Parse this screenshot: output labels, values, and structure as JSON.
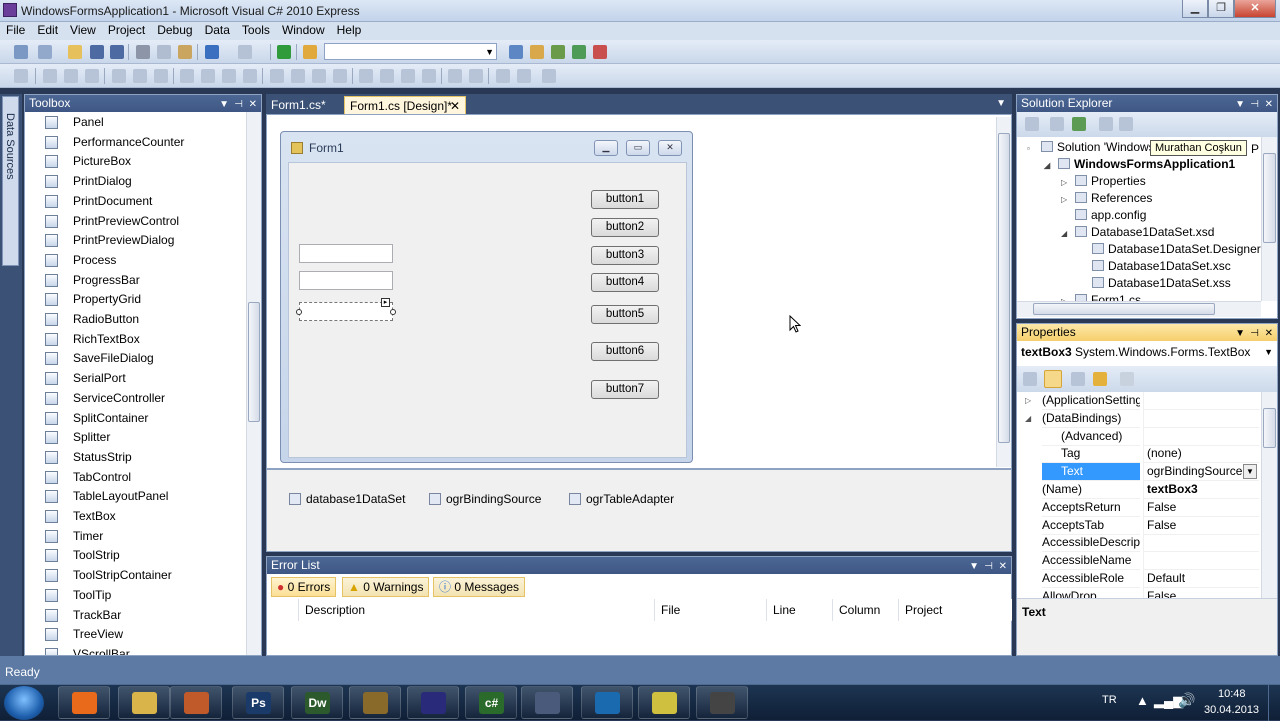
{
  "window": {
    "title": "WindowsFormsApplication1 - Microsoft Visual C# 2010 Express",
    "minimize": "▁",
    "maximize": "❐",
    "close": "✕"
  },
  "menu": [
    "File",
    "Edit",
    "View",
    "Project",
    "Debug",
    "Data",
    "Tools",
    "Window",
    "Help"
  ],
  "data_sources_tab": "Data Sources",
  "toolbox": {
    "title": "Toolbox",
    "items": [
      "Panel",
      "PerformanceCounter",
      "PictureBox",
      "PrintDialog",
      "PrintDocument",
      "PrintPreviewControl",
      "PrintPreviewDialog",
      "Process",
      "ProgressBar",
      "PropertyGrid",
      "RadioButton",
      "RichTextBox",
      "SaveFileDialog",
      "SerialPort",
      "ServiceController",
      "SplitContainer",
      "Splitter",
      "StatusStrip",
      "TabControl",
      "TableLayoutPanel",
      "TextBox",
      "Timer",
      "ToolStrip",
      "ToolStripContainer",
      "ToolTip",
      "TrackBar",
      "TreeView",
      "VScrollBar"
    ]
  },
  "doc_tabs": [
    "Form1.cs*",
    "Form1.cs [Design]*"
  ],
  "form": {
    "title": "Form1",
    "buttons": [
      "button1",
      "button2",
      "button3",
      "button4",
      "button5",
      "button6",
      "button7"
    ]
  },
  "component_tray": [
    "database1DataSet",
    "ogrBindingSource",
    "ogrTableAdapter"
  ],
  "error_list": {
    "title": "Error List",
    "errors": "0 Errors",
    "warnings": "0 Warnings",
    "messages": "0 Messages",
    "columns": [
      "Description",
      "File",
      "Line",
      "Column",
      "Project"
    ]
  },
  "solution_explorer": {
    "title": "Solution Explorer",
    "tooltip": "Murathan Coşkun",
    "items": [
      "Solution 'WindowsFor",
      "WindowsFormsApplication1",
      "Properties",
      "References",
      "app.config",
      "Database1DataSet.xsd",
      "Database1DataSet.Designer.cs",
      "Database1DataSet.xsc",
      "Database1DataSet.xss",
      "Form1.cs"
    ],
    "trail": "P"
  },
  "properties": {
    "title": "Properties",
    "object": "textBox3",
    "type": "System.Windows.Forms.TextBox",
    "rows": [
      {
        "k": "(ApplicationSettings)",
        "v": ""
      },
      {
        "k": "(DataBindings)",
        "v": ""
      },
      {
        "k": "(Advanced)",
        "v": ""
      },
      {
        "k": "Tag",
        "v": "(none)"
      },
      {
        "k": "Text",
        "v": "ogrBindingSource -"
      },
      {
        "k": "(Name)",
        "v": "textBox3"
      },
      {
        "k": "AcceptsReturn",
        "v": "False"
      },
      {
        "k": "AcceptsTab",
        "v": "False"
      },
      {
        "k": "AccessibleDescriptic",
        "v": ""
      },
      {
        "k": "AccessibleName",
        "v": ""
      },
      {
        "k": "AccessibleRole",
        "v": "Default"
      },
      {
        "k": "AllowDrop",
        "v": "False"
      }
    ],
    "description_title": "Text"
  },
  "status": "Ready",
  "taskbar": {
    "apps": [
      "firefox",
      "explorer",
      "media",
      "Ps",
      "Dw",
      "tool",
      "globe",
      "c#",
      "vbox",
      "teamviewer",
      "folder",
      "camtasia"
    ],
    "lang": "TR",
    "time": "10:48",
    "date": "30.04.2013"
  },
  "colors": {
    "frame": "#293955",
    "panel_head": "#4d6895",
    "active_head": "#f6cf6c",
    "selection": "#3399ff"
  }
}
